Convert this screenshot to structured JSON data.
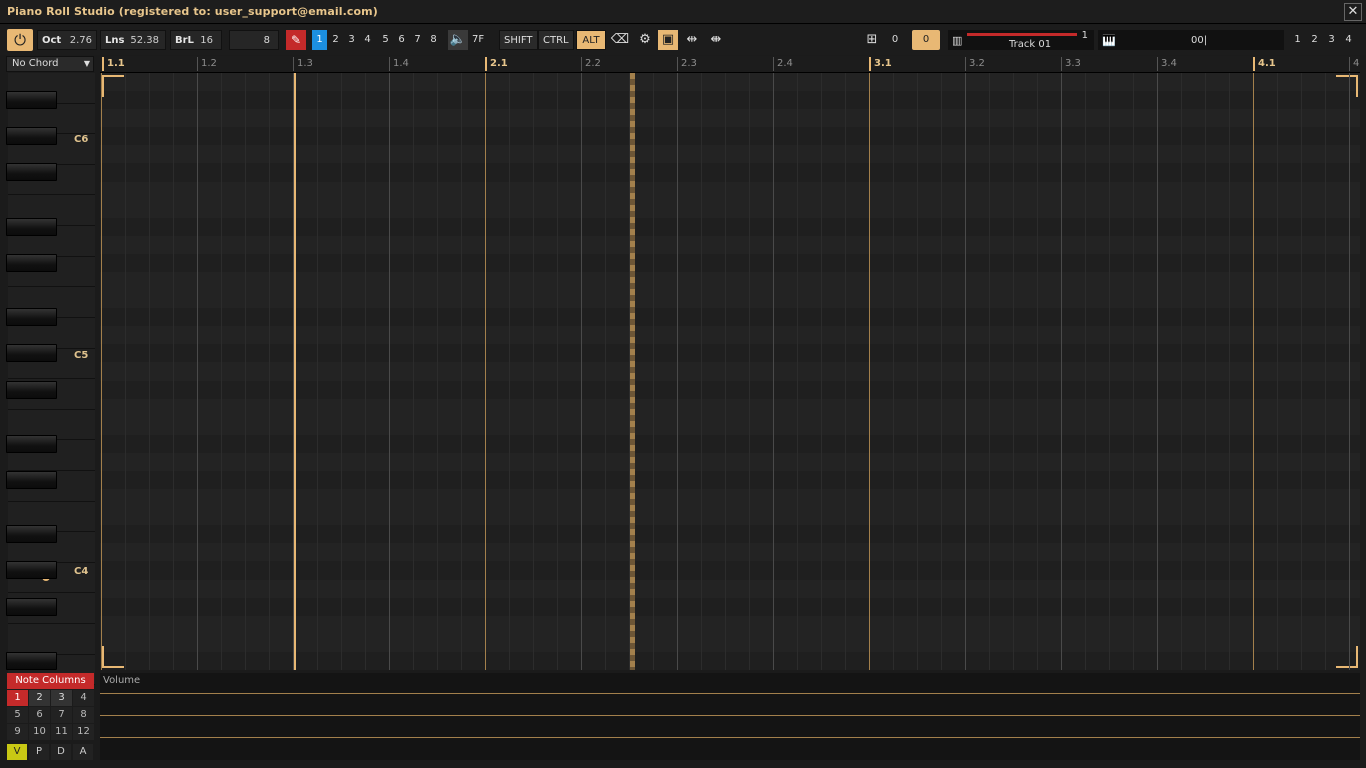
{
  "window": {
    "title": "Piano Roll Studio  (registered to: user_support@email.com)",
    "close_label": "✕"
  },
  "toolbar": {
    "oct_label": "Oct",
    "oct_value": "2.76",
    "lns_label": "Lns",
    "lns_value": "52.38",
    "brl_label": "BrL",
    "brl_value": "16",
    "quant_value": "8",
    "groups": [
      "1",
      "2",
      "3",
      "4",
      "5",
      "6",
      "7",
      "8"
    ],
    "selected_group": "1",
    "vel_value": "7F",
    "mod_shift": "SHIFT",
    "mod_ctrl": "CTRL",
    "mod_alt": "ALT",
    "counter_a": "0",
    "counter_b": "0",
    "track_name": "Track 01",
    "track_num": "1",
    "instr_value": "00|",
    "right_nums": [
      "1",
      "2",
      "3",
      "4"
    ]
  },
  "chord": {
    "selected": "No Chord"
  },
  "keys": {
    "labels": [
      "C6",
      "C5",
      "C4"
    ]
  },
  "ruler": {
    "marks": [
      "1.1",
      "1.2",
      "1.3",
      "1.4",
      "2.1",
      "2.2",
      "2.3",
      "2.4",
      "3.1",
      "3.2",
      "3.3",
      "3.4",
      "4.1",
      "4"
    ]
  },
  "note_columns": {
    "title": "Note Columns",
    "items": [
      "1",
      "2",
      "3",
      "4",
      "5",
      "6",
      "7",
      "8",
      "9",
      "10",
      "11",
      "12"
    ],
    "selected": "1"
  },
  "lane_buttons": [
    "V",
    "P",
    "D",
    "A"
  ],
  "automation": {
    "lane_title": "Volume"
  },
  "colors": {
    "accent": "#e8b874",
    "red": "#c42a2a",
    "blue": "#1c8fe0"
  }
}
